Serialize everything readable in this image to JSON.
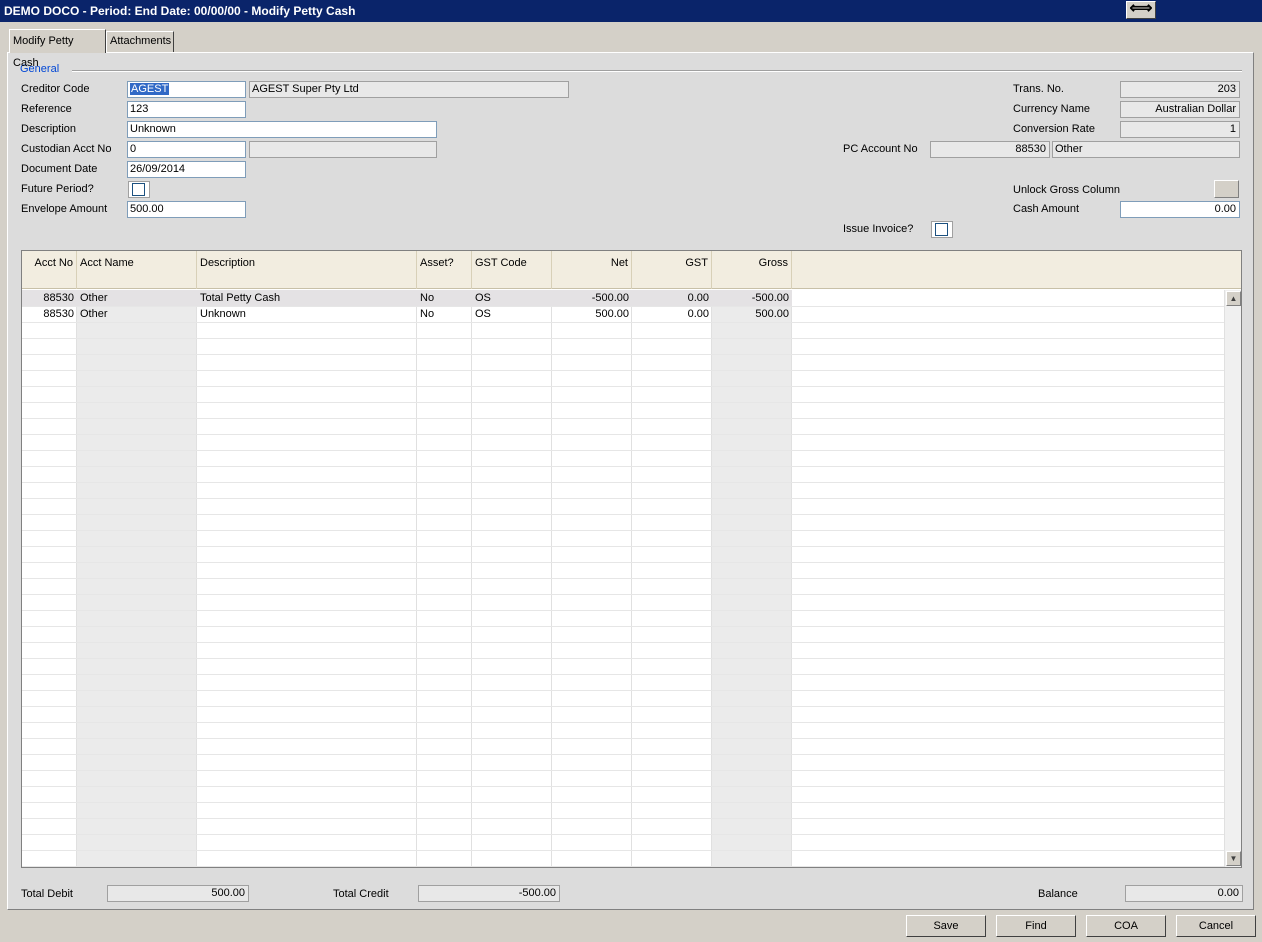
{
  "window": {
    "title": "DEMO DOCO  - Period:  End Date: 00/00/00 - Modify Petty Cash",
    "resize_icon": "double-arrow-icon",
    "resize_glyph": "⟺"
  },
  "tabs": [
    {
      "label": "Modify Petty Cash",
      "active": true
    },
    {
      "label": "Attachments",
      "active": false
    }
  ],
  "general": {
    "group_label": "General",
    "creditor_code_label": "Creditor Code",
    "creditor_code": "AGEST",
    "creditor_name": "AGEST Super Pty Ltd",
    "reference_label": "Reference",
    "reference": "123",
    "description_label": "Description",
    "description": "Unknown",
    "custodian_label": "Custodian Acct No",
    "custodian_acct": "0",
    "custodian_name": "",
    "document_date_label": "Document Date",
    "document_date": "26/09/2014",
    "future_period_label": "Future Period?",
    "future_period": false,
    "envelope_label": "Envelope Amount",
    "envelope_amount": "500.00",
    "trans_no_label": "Trans. No.",
    "trans_no": "203",
    "currency_label": "Currency Name",
    "currency": "Australian Dollar",
    "conversion_label": "Conversion Rate",
    "conversion_rate": "1",
    "pc_account_label": "PC Account No",
    "pc_account_no": "88530",
    "pc_account_name": "Other",
    "unlock_gross_label": "Unlock Gross Column",
    "cash_amount_label": "Cash Amount",
    "cash_amount": "0.00",
    "issue_invoice_label": "Issue Invoice?",
    "issue_invoice": false
  },
  "grid": {
    "columns": [
      "Acct No",
      "Acct Name",
      "Description",
      "Asset?",
      "GST Code",
      "Net",
      "GST",
      "Gross"
    ],
    "rows": [
      {
        "acct_no": "88530",
        "acct_name": "Other",
        "description": "Total Petty Cash",
        "asset": "No",
        "gst_code": "OS",
        "net": "-500.00",
        "gst": "0.00",
        "gross": "-500.00"
      },
      {
        "acct_no": "88530",
        "acct_name": "Other",
        "description": "Unknown",
        "asset": "No",
        "gst_code": "OS",
        "net": "500.00",
        "gst": "0.00",
        "gross": "500.00"
      }
    ],
    "scroll_up_glyph": "▲",
    "scroll_down_glyph": "▼"
  },
  "totals": {
    "total_debit_label": "Total Debit",
    "total_debit": "500.00",
    "total_credit_label": "Total Credit",
    "total_credit": "-500.00",
    "balance_label": "Balance",
    "balance": "0.00"
  },
  "buttons": {
    "save": "Save",
    "find": "Find",
    "coa": "COA",
    "cancel": "Cancel"
  }
}
